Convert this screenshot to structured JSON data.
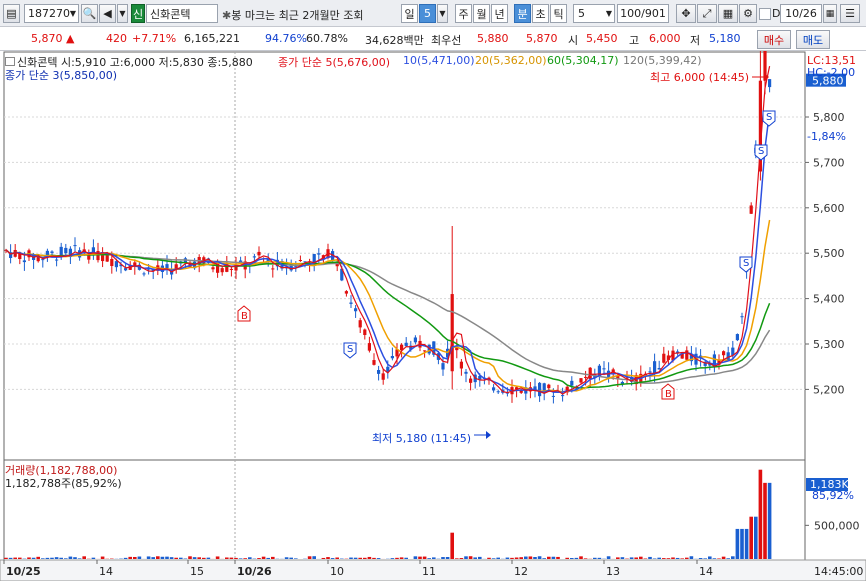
{
  "toolbar": {
    "code": "187270",
    "name_badge": "신",
    "stock_name": "신화콘텍",
    "notice": "봉 마크는 최근 2개월만 조회",
    "period_day": "일",
    "period_num": "5",
    "periods": [
      "주",
      "월",
      "년",
      "분",
      "초",
      "틱"
    ],
    "interval": "5",
    "page_count": "100/901",
    "checkbox_label": "D",
    "date": "10/26"
  },
  "quote": {
    "price": "5,870",
    "change": "420",
    "change_pct": "+7.71%",
    "volume": "6,165,221",
    "ratio1": "94.76%",
    "ratio2": "60.78%",
    "amount": "34,628백만",
    "best_label": "최우선",
    "best_ask": "5,880",
    "best_bid": "5,870",
    "open_label": "시",
    "open": "5,450",
    "high_label": "고",
    "high": "6,000",
    "low_label": "저",
    "low": "5,180",
    "buy": "매수",
    "sell": "매도"
  },
  "legend": {
    "ohlc": "신화콘텍 시:5,910 고:6,000 저:5,830 종:5,880",
    "ma5": "종가 단순 5(5,676,00)",
    "ma10": "10(5,471,00)",
    "ma20": "20(5,362,00)",
    "ma60": "60(5,304,17)",
    "ma120": "120(5,399,42)",
    "ma3": "종가 단순 3(5,850,00)",
    "vol": "거래량(1,182,788,00)",
    "vol2": "1,182,788주(85,92%)"
  },
  "annotations": {
    "high": "최고 6,000 (14:45)",
    "low": "최저 5,180 (11:45)",
    "marker_s": "S",
    "marker_b": "B"
  },
  "right_axis": {
    "lc": "LC:13,51",
    "hc": "HC:-2,00",
    "current": "5,880",
    "current_pct": "-1,84%",
    "vol_current": "1,183K",
    "vol_pct": "85,92%"
  },
  "colors": {
    "up": "#e01010",
    "down": "#1a5fd0",
    "ma5": "#e0101a",
    "ma10": "#2c4fe0",
    "ma20": "#f0a000",
    "ma60": "#119911",
    "ma120": "#888888"
  },
  "chart_data": {
    "type": "candlestick",
    "y_ticks": [
      "5,800",
      "5,700",
      "5,600",
      "5,500",
      "5,400",
      "5,300",
      "5,200"
    ],
    "y_values": [
      5800,
      5700,
      5600,
      5500,
      5400,
      5300,
      5200
    ],
    "vol_ticks": [
      "500,000"
    ],
    "vol_tick_values": [
      500000
    ],
    "x_labels": [
      "10/25",
      "14",
      "15",
      "10/26",
      "10",
      "11",
      "12",
      "13",
      "14",
      "14:45:00"
    ],
    "high": 6000,
    "low": 5180,
    "last_close": 5880,
    "last_volume": 1182788
  }
}
